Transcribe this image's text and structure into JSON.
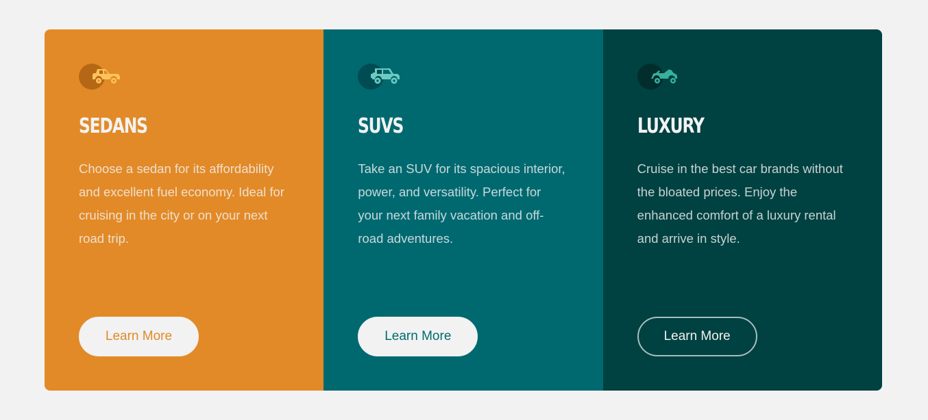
{
  "cards": [
    {
      "title": "SEDANS",
      "text": "Choose a sedan for its affordability and excellent fuel economy. Ideal for cruising in the city or on your next road trip.",
      "button": "Learn More",
      "icon": "sedan-car-icon",
      "color": "#e28a27"
    },
    {
      "title": "SUVS",
      "text": "Take an SUV for its spacious interior, power, and versatility. Perfect for your next family vacation and off-road adventures.",
      "button": "Learn More",
      "icon": "suv-car-icon",
      "color": "#006970"
    },
    {
      "title": "LUXURY",
      "text": "Cruise in the best car brands without the bloated prices. Enjoy the enhanced comfort of a luxury rental and arrive in style.",
      "button": "Learn More",
      "icon": "luxury-car-icon",
      "color": "#004141"
    }
  ],
  "colors": {
    "background": "#f2f2f2",
    "sedans_icon": "#ffc35b",
    "suvs_icon": "#6ccbc1",
    "luxury_icon": "#36b29c"
  }
}
